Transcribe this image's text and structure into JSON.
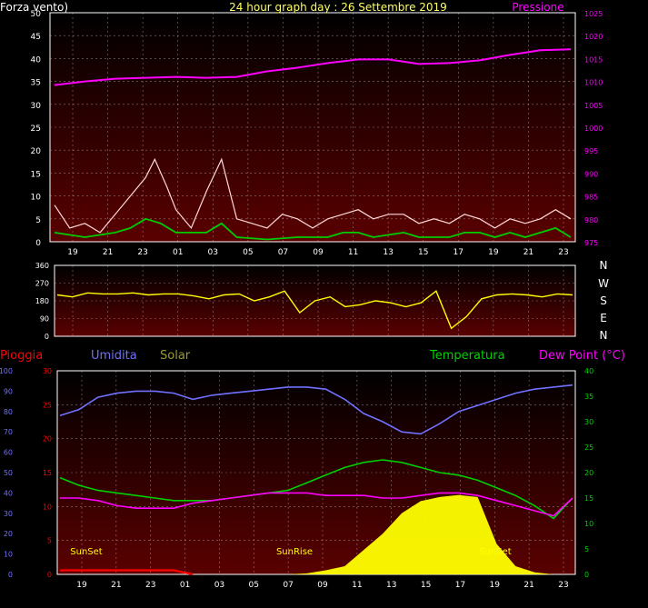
{
  "colors": {
    "background": "#000000",
    "frame": "#ffffff",
    "grid": "#c8c8c8",
    "pressure": "#ff00ff",
    "wind_gust": "#ffd8d8",
    "wind_avg": "#00cc00",
    "wind_dir": "#ffff00",
    "humidity": "#7070ff",
    "temperature": "#00d000",
    "dewpoint": "#ff00ff",
    "rain": "#ff0000",
    "solar": "#ffff00",
    "title": "#ffff66",
    "sunlabels": "#ffff00",
    "plot_top": "#000000",
    "plot_bottom": "#5a0000"
  },
  "header": {
    "left": "Forza vento)",
    "center": "24 hour graph day : 26 Settembre 2019",
    "right": "Pressione"
  },
  "compass": [
    "N",
    "W",
    "S",
    "E",
    "N"
  ],
  "legend": {
    "rain": "Pioggia",
    "humidity": "Umidita",
    "solar": "Solar",
    "temperature": "Temperatura",
    "dewpoint": "Dew Point (°C)"
  },
  "time_labels": [
    "19",
    "21",
    "23",
    "01",
    "03",
    "05",
    "07",
    "09",
    "11",
    "13",
    "15",
    "17",
    "19",
    "21",
    "23"
  ],
  "sun_labels": [
    "SunSet",
    "SunRise",
    "SunSet"
  ],
  "chart_data": [
    {
      "type": "line",
      "name": "wind-pressure",
      "y_left_ticks": [
        "0",
        "5",
        "10",
        "15",
        "20",
        "25",
        "30",
        "35",
        "40",
        "45",
        "50"
      ],
      "y_right_ticks": [
        "975",
        "980",
        "985",
        "990",
        "995",
        "1000",
        "1005",
        "1010",
        "1015",
        "1020",
        "1025"
      ],
      "ylim_left": [
        0,
        50
      ],
      "ylim_right": [
        975,
        1025
      ],
      "grid": true,
      "pressure": [
        [
          0,
          1009.2
        ],
        [
          1,
          1010.0
        ],
        [
          2,
          1010.6
        ],
        [
          3,
          1010.8
        ],
        [
          4,
          1011.0
        ],
        [
          5,
          1010.8
        ],
        [
          6,
          1011.0
        ],
        [
          7,
          1012.2
        ],
        [
          8,
          1013.0
        ],
        [
          9,
          1014.0
        ],
        [
          10,
          1014.8
        ],
        [
          11,
          1014.8
        ],
        [
          12,
          1013.8
        ],
        [
          13,
          1014.0
        ],
        [
          14,
          1014.6
        ],
        [
          15,
          1015.8
        ],
        [
          16,
          1016.8
        ],
        [
          17,
          1017.0
        ]
      ],
      "wind_gust": [
        [
          0,
          8
        ],
        [
          0.5,
          3
        ],
        [
          1,
          4
        ],
        [
          1.5,
          2
        ],
        [
          2,
          6
        ],
        [
          2.5,
          10
        ],
        [
          3,
          14
        ],
        [
          3.3,
          18
        ],
        [
          3.7,
          12
        ],
        [
          4,
          7
        ],
        [
          4.5,
          3
        ],
        [
          5,
          11
        ],
        [
          5.5,
          18
        ],
        [
          6,
          5
        ],
        [
          6.5,
          4
        ],
        [
          7,
          3
        ],
        [
          7.5,
          6
        ],
        [
          8,
          5
        ],
        [
          8.5,
          3
        ],
        [
          9,
          5
        ],
        [
          9.5,
          6
        ],
        [
          10,
          7
        ],
        [
          10.5,
          5
        ],
        [
          11,
          6
        ],
        [
          11.5,
          6
        ],
        [
          12,
          4
        ],
        [
          12.5,
          5
        ],
        [
          13,
          4
        ],
        [
          13.5,
          6
        ],
        [
          14,
          5
        ],
        [
          14.5,
          3
        ],
        [
          15,
          5
        ],
        [
          15.5,
          4
        ],
        [
          16,
          5
        ],
        [
          16.5,
          7
        ],
        [
          17,
          5
        ]
      ],
      "wind_avg": [
        [
          0,
          2
        ],
        [
          1,
          1
        ],
        [
          2,
          2
        ],
        [
          2.5,
          3
        ],
        [
          3,
          5
        ],
        [
          3.5,
          4
        ],
        [
          4,
          2
        ],
        [
          5,
          2
        ],
        [
          5.5,
          4
        ],
        [
          6,
          1
        ],
        [
          7,
          0.5
        ],
        [
          8,
          1
        ],
        [
          9,
          1
        ],
        [
          9.5,
          2
        ],
        [
          10,
          2
        ],
        [
          10.5,
          1
        ],
        [
          11,
          1.5
        ],
        [
          11.5,
          2
        ],
        [
          12,
          1
        ],
        [
          13,
          1
        ],
        [
          13.5,
          2
        ],
        [
          14,
          2
        ],
        [
          14.5,
          1
        ],
        [
          15,
          2
        ],
        [
          15.5,
          1
        ],
        [
          16,
          2
        ],
        [
          16.5,
          3
        ],
        [
          17,
          1
        ]
      ]
    },
    {
      "type": "line",
      "name": "wind-direction",
      "y_left_ticks": [
        "0",
        "90",
        "180",
        "270",
        "360"
      ],
      "ylim": [
        0,
        360
      ],
      "grid": true,
      "values": [
        [
          0,
          210
        ],
        [
          0.5,
          200
        ],
        [
          1,
          220
        ],
        [
          1.5,
          215
        ],
        [
          2,
          215
        ],
        [
          2.5,
          220
        ],
        [
          3,
          210
        ],
        [
          3.5,
          215
        ],
        [
          4,
          215
        ],
        [
          4.5,
          205
        ],
        [
          5,
          190
        ],
        [
          5.5,
          210
        ],
        [
          6,
          215
        ],
        [
          6.5,
          180
        ],
        [
          7,
          200
        ],
        [
          7.5,
          230
        ],
        [
          8,
          120
        ],
        [
          8.5,
          180
        ],
        [
          9,
          200
        ],
        [
          9.5,
          150
        ],
        [
          10,
          160
        ],
        [
          10.5,
          180
        ],
        [
          11,
          170
        ],
        [
          11.5,
          150
        ],
        [
          12,
          170
        ],
        [
          12.5,
          230
        ],
        [
          13,
          40
        ],
        [
          13.5,
          100
        ],
        [
          14,
          190
        ],
        [
          14.5,
          210
        ],
        [
          15,
          215
        ],
        [
          15.5,
          210
        ],
        [
          16,
          200
        ],
        [
          16.5,
          215
        ],
        [
          17,
          210
        ]
      ]
    },
    {
      "type": "line",
      "name": "temperature-humidity",
      "y_humidity_ticks": [
        "0",
        "10",
        "20",
        "30",
        "40",
        "50",
        "60",
        "70",
        "80",
        "90",
        "100"
      ],
      "y_rain_ticks": [
        "0",
        "5",
        "10",
        "15",
        "20",
        "25",
        "30"
      ],
      "y_temp_ticks": [
        "0",
        "5",
        "10",
        "15",
        "20",
        "25",
        "30",
        "35",
        "40"
      ],
      "ylim_humidity": [
        0,
        100
      ],
      "ylim_rain": [
        0,
        30
      ],
      "ylim_temp": [
        0,
        40
      ],
      "grid": true,
      "humidity": [
        [
          0,
          78
        ],
        [
          0.5,
          81
        ],
        [
          1,
          87
        ],
        [
          1.5,
          89
        ],
        [
          2,
          90
        ],
        [
          2.5,
          90
        ],
        [
          3,
          89
        ],
        [
          3.5,
          86
        ],
        [
          4,
          88
        ],
        [
          4.5,
          89
        ],
        [
          5,
          90
        ],
        [
          5.5,
          91
        ],
        [
          6,
          92
        ],
        [
          6.5,
          92
        ],
        [
          7,
          91
        ],
        [
          7.5,
          86
        ],
        [
          8,
          79
        ],
        [
          8.5,
          75
        ],
        [
          9,
          70
        ],
        [
          9.5,
          69
        ],
        [
          10,
          74
        ],
        [
          10.5,
          80
        ],
        [
          11,
          83
        ],
        [
          11.5,
          86
        ],
        [
          12,
          89
        ],
        [
          12.5,
          91
        ],
        [
          13,
          92
        ],
        [
          13.5,
          93
        ]
      ],
      "temperature": [
        [
          0,
          19
        ],
        [
          0.5,
          17.5
        ],
        [
          1,
          16.5
        ],
        [
          1.5,
          16
        ],
        [
          2,
          15.5
        ],
        [
          2.5,
          15
        ],
        [
          3,
          14.5
        ],
        [
          3.5,
          14.5
        ],
        [
          4,
          14.5
        ],
        [
          4.5,
          15
        ],
        [
          5,
          15.5
        ],
        [
          5.5,
          16
        ],
        [
          6,
          16.5
        ],
        [
          6.5,
          18
        ],
        [
          7,
          19.5
        ],
        [
          7.5,
          21
        ],
        [
          8,
          22
        ],
        [
          8.5,
          22.5
        ],
        [
          9,
          22
        ],
        [
          9.5,
          21
        ],
        [
          10,
          20
        ],
        [
          10.5,
          19.5
        ],
        [
          11,
          18.5
        ],
        [
          11.5,
          17
        ],
        [
          12,
          15.5
        ],
        [
          12.5,
          13.5
        ],
        [
          13,
          11
        ],
        [
          13.5,
          15
        ]
      ],
      "dewpoint": [
        [
          0,
          15
        ],
        [
          0.5,
          15
        ],
        [
          1,
          14.5
        ],
        [
          1.5,
          13.5
        ],
        [
          2,
          13
        ],
        [
          2.5,
          13
        ],
        [
          3,
          13
        ],
        [
          3.5,
          14
        ],
        [
          4,
          14.5
        ],
        [
          4.5,
          15
        ],
        [
          5,
          15.5
        ],
        [
          5.5,
          16
        ],
        [
          6,
          16
        ],
        [
          6.5,
          16
        ],
        [
          7,
          15.5
        ],
        [
          7.5,
          15.5
        ],
        [
          8,
          15.5
        ],
        [
          8.5,
          15
        ],
        [
          9,
          15
        ],
        [
          9.5,
          15.5
        ],
        [
          10,
          16
        ],
        [
          10.5,
          16
        ],
        [
          11,
          15.5
        ],
        [
          11.5,
          14.5
        ],
        [
          12,
          13.5
        ],
        [
          12.5,
          12.5
        ],
        [
          13,
          11.5
        ],
        [
          13.5,
          15
        ]
      ],
      "rain": [
        [
          0,
          0.6
        ],
        [
          1,
          0.6
        ],
        [
          2,
          0.6
        ],
        [
          3,
          0.6
        ],
        [
          3.5,
          0
        ]
      ],
      "solar": [
        [
          0,
          0
        ],
        [
          6,
          0
        ],
        [
          6.5,
          5
        ],
        [
          7,
          20
        ],
        [
          7.5,
          40
        ],
        [
          8,
          120
        ],
        [
          8.5,
          200
        ],
        [
          9,
          300
        ],
        [
          9.5,
          360
        ],
        [
          10,
          380
        ],
        [
          10.5,
          390
        ],
        [
          11,
          380
        ],
        [
          11.5,
          150
        ],
        [
          12,
          40
        ],
        [
          12.5,
          10
        ],
        [
          13,
          0
        ],
        [
          13.5,
          0
        ]
      ]
    }
  ]
}
